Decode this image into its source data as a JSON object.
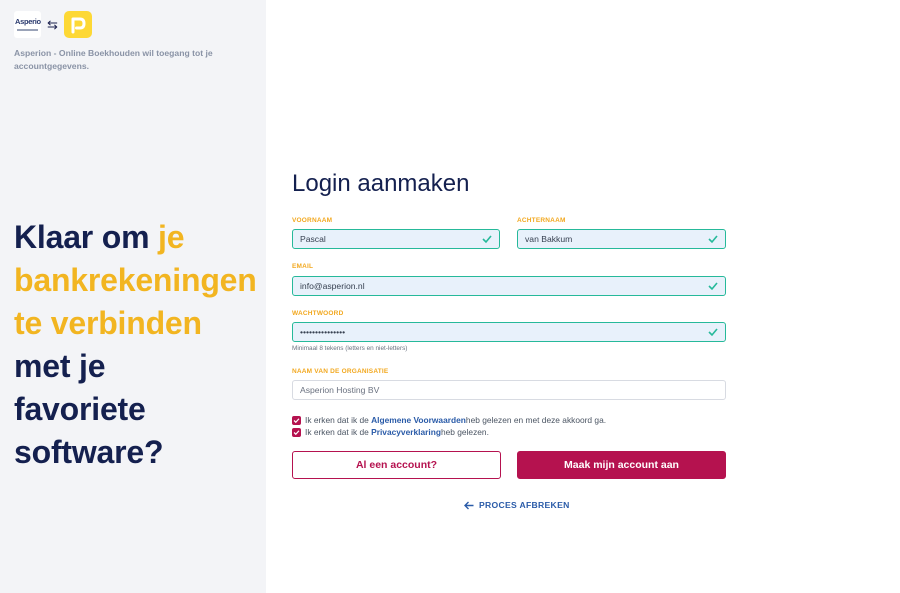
{
  "left": {
    "logo_text": "Asperion",
    "swap_symbol": "⇆",
    "access_text": "Asperion - Online Boekhouden wil toegang tot je accountgegevens.",
    "headline": {
      "line1_a": "Klaar om ",
      "line1_b": "je",
      "line2": "bankrekeningen",
      "line3": "te verbinden",
      "line4": "met je",
      "line5": "favoriete",
      "line6": "software?"
    },
    "highlight_color": "#f2b521"
  },
  "form": {
    "title": "Login aanmaken",
    "firstname": {
      "label": "VOORNAAM",
      "value": "Pascal"
    },
    "lastname": {
      "label": "ACHTERNAAM",
      "value": "van Bakkum"
    },
    "email": {
      "label": "EMAIL",
      "value": "info@asperion.nl"
    },
    "password": {
      "label": "WACHTWOORD",
      "value": "•••••••••••••••",
      "hint": "Minimaal 8 tekens (letters en niet-letters)"
    },
    "organisation": {
      "label": "NAAM VAN DE ORGANISATIE",
      "placeholder": "Asperion Hosting BV"
    },
    "terms": {
      "pre": "Ik erken dat ik de ",
      "link": "Algemene Voorwaarden",
      "post": " heb gelezen en met deze akkoord ga."
    },
    "privacy": {
      "pre": "Ik erken dat ik de ",
      "link": "Privacyverklaring",
      "post": " heb gelezen."
    },
    "btn_existing": "Al een account?",
    "btn_create": "Maak mijn account aan",
    "abort": "PROCES AFBREKEN"
  },
  "colors": {
    "brand": "#b5124f",
    "valid": "#26b99a",
    "navy": "#14204f",
    "link": "#2a5ba8"
  }
}
